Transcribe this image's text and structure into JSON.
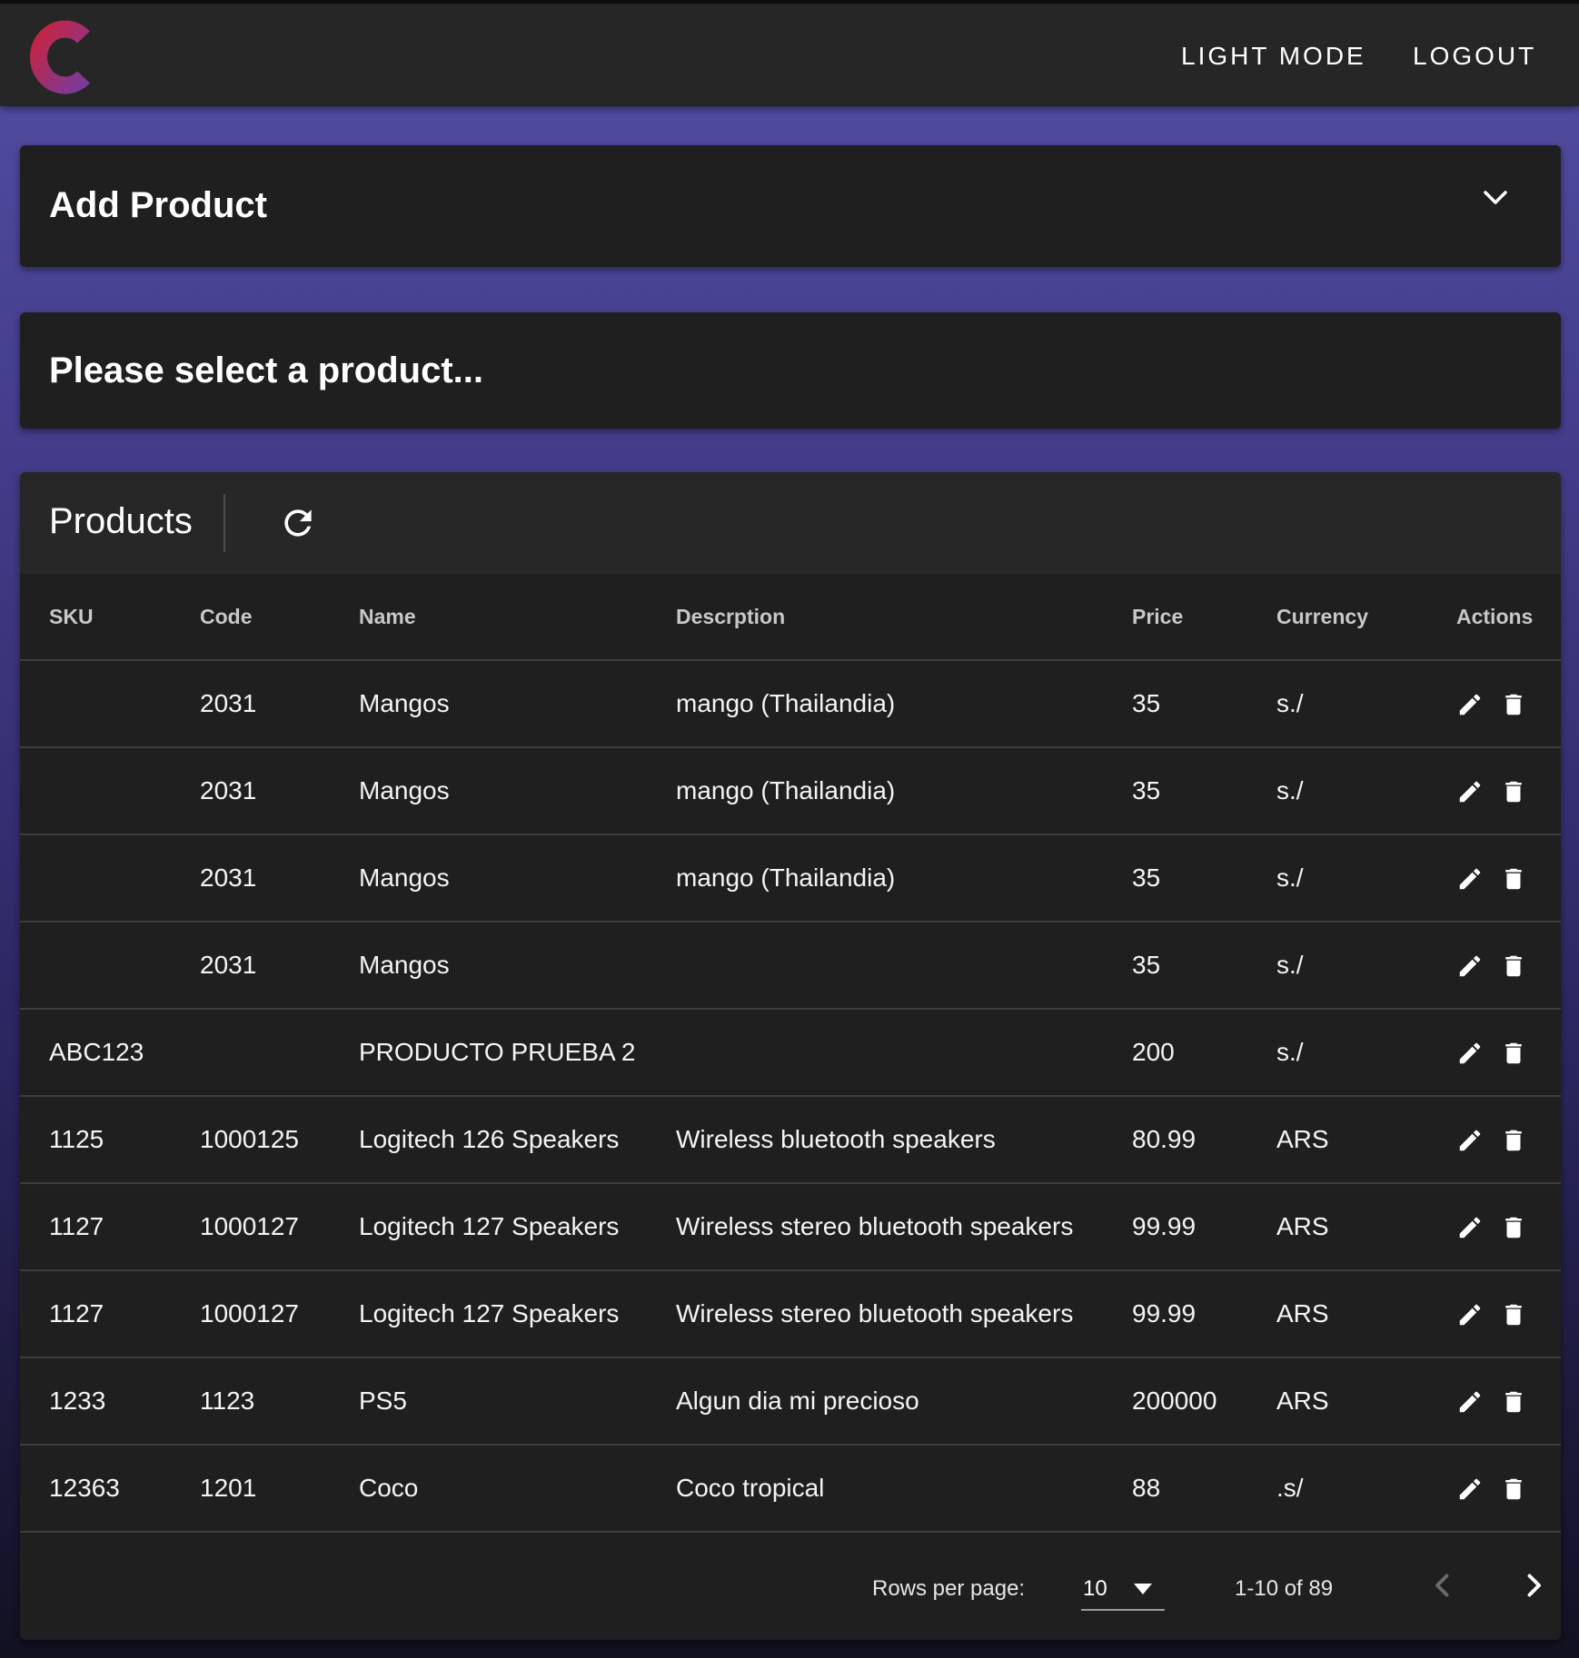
{
  "appbar": {
    "light_mode_label": "LIGHT MODE",
    "logout_label": "LOGOUT",
    "brand_colors": [
      "#c8243f",
      "#7a3a9c"
    ]
  },
  "add_product": {
    "title": "Add Product",
    "icon": "chevron-down-icon"
  },
  "selection": {
    "message": "Please select a product..."
  },
  "products": {
    "title": "Products",
    "refresh_icon": "refresh-icon",
    "columns": [
      "SKU",
      "Code",
      "Name",
      "Descrption",
      "Price",
      "Currency",
      "Actions"
    ],
    "rows": [
      {
        "sku": "",
        "code": "2031",
        "name": "Mangos",
        "description": "mango (Thailandia)",
        "price": "35",
        "currency": "s./"
      },
      {
        "sku": "",
        "code": "2031",
        "name": "Mangos",
        "description": "mango (Thailandia)",
        "price": "35",
        "currency": "s./"
      },
      {
        "sku": "",
        "code": "2031",
        "name": "Mangos",
        "description": "mango (Thailandia)",
        "price": "35",
        "currency": "s./"
      },
      {
        "sku": "",
        "code": "2031",
        "name": "Mangos",
        "description": "",
        "price": "35",
        "currency": "s./"
      },
      {
        "sku": "ABC123",
        "code": "",
        "name": "PRODUCTO PRUEBA 2",
        "description": "",
        "price": "200",
        "currency": "s./"
      },
      {
        "sku": "1125",
        "code": "1000125",
        "name": "Logitech 126 Speakers",
        "description": "Wireless bluetooth speakers",
        "price": "80.99",
        "currency": "ARS"
      },
      {
        "sku": "1127",
        "code": "1000127",
        "name": "Logitech 127 Speakers",
        "description": "Wireless stereo bluetooth speakers",
        "price": "99.99",
        "currency": "ARS"
      },
      {
        "sku": "1127",
        "code": "1000127",
        "name": "Logitech 127 Speakers",
        "description": "Wireless stereo bluetooth speakers",
        "price": "99.99",
        "currency": "ARS"
      },
      {
        "sku": "1233",
        "code": "1123",
        "name": "PS5",
        "description": "Algun dia mi precioso",
        "price": "200000",
        "currency": "ARS"
      },
      {
        "sku": "12363",
        "code": "1201",
        "name": "Coco",
        "description": "Coco tropical",
        "price": "88",
        "currency": ".s/"
      }
    ],
    "row_actions": [
      "pencil-icon",
      "trash-icon"
    ]
  },
  "pagination": {
    "rows_per_page_label": "Rows per page:",
    "rows_per_page": "10",
    "range": "1-10 of 89",
    "prev_icon": "chevron-left-icon",
    "next_icon": "chevron-right-icon"
  }
}
